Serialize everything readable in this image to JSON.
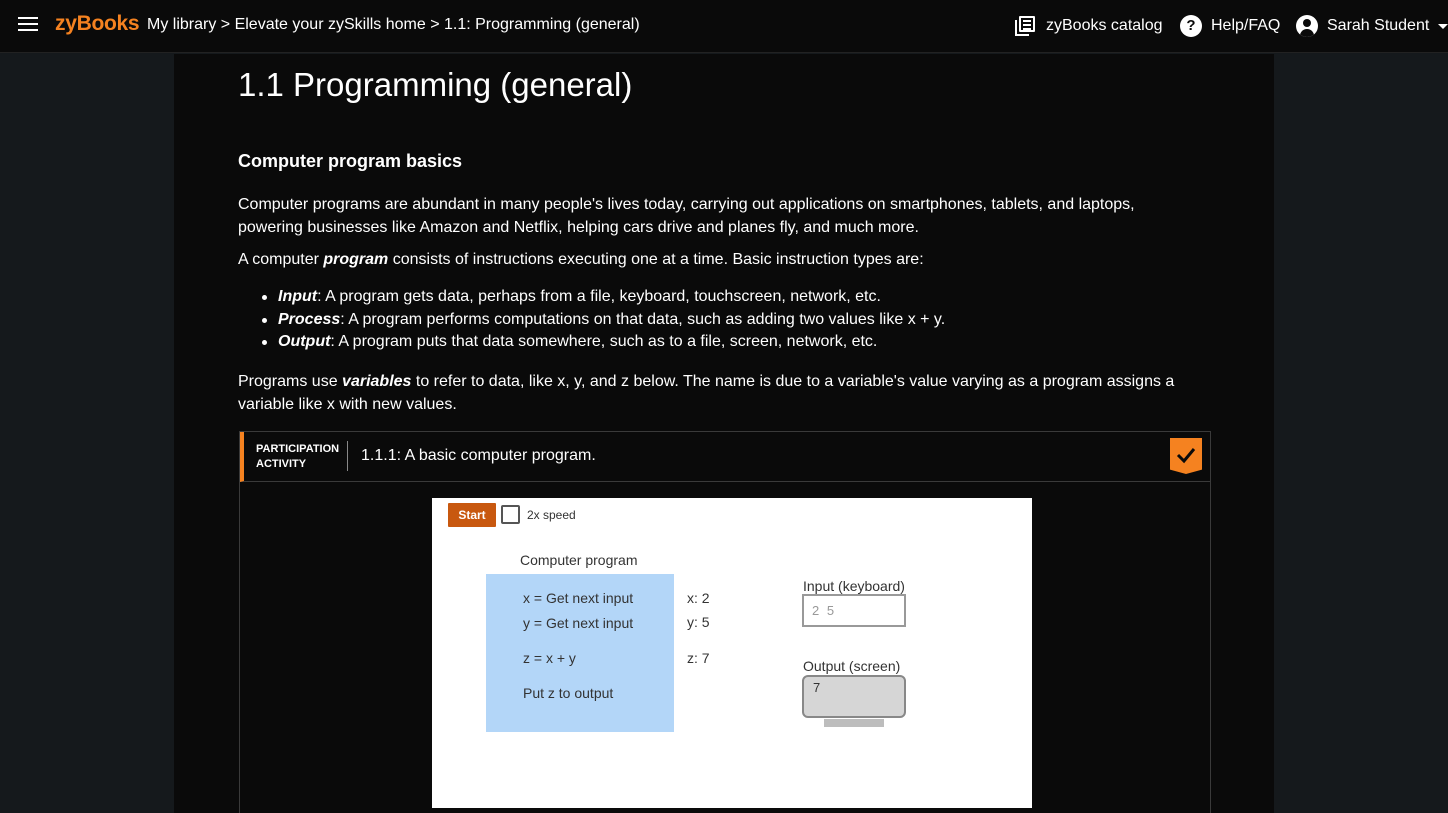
{
  "header": {
    "logo": "zyBooks",
    "breadcrumb": {
      "library": "My library",
      "sep1": " > ",
      "home": "Elevate your zySkills home",
      "sep2": " > ",
      "section": "1.1: Programming (general)"
    },
    "catalog_label": "zyBooks catalog",
    "help_icon_glyph": "?",
    "help_label": "Help/FAQ",
    "user_name": "Sarah Student",
    "accent_color": "#f58220"
  },
  "main": {
    "title": "1.1 Programming (general)",
    "section_heading": "Computer program basics",
    "p1": "Computer programs are abundant in many people's lives today, carrying out applications on smartphones, tablets, and laptops, powering businesses like Amazon and Netflix, helping cars drive and planes fly, and much more.",
    "p2": {
      "before": "A computer ",
      "term": "program",
      "after": " consists of instructions executing one at a time. Basic instruction types are:"
    },
    "bullets": [
      {
        "term": "Input",
        "text": ": A program gets data, perhaps from a file, keyboard, touchscreen, network, etc."
      },
      {
        "term": "Process",
        "text": ": A program performs computations on that data, such as adding two values like x + y."
      },
      {
        "term": "Output",
        "text": ": A program puts that data somewhere, such as to a file, screen, network, etc."
      }
    ],
    "p3": {
      "before": "Programs use ",
      "term": "variables",
      "after": " to refer to data, like x, y, and z below. The name is due to a variable's value varying as a program assigns a variable like x with new values."
    }
  },
  "activity": {
    "label_line1": "PARTICIPATION",
    "label_line2": "ACTIVITY",
    "title": "1.1.1: A basic computer program.",
    "completed": true,
    "start_label": "Start",
    "speed_label": "2x speed",
    "speed_checked": false,
    "program_title": "Computer program",
    "program_lines": [
      "x = Get next input",
      "y = Get next input",
      "z = x + y",
      "Put z to output"
    ],
    "variables": [
      "x: 2",
      "y: 5",
      "z: 7"
    ],
    "input_title": "Input (keyboard)",
    "input_value": "2 5",
    "output_title": "Output (screen)",
    "output_value": "7",
    "program_bg_color": "#b3d6f8",
    "start_button_color": "#c8580f"
  }
}
